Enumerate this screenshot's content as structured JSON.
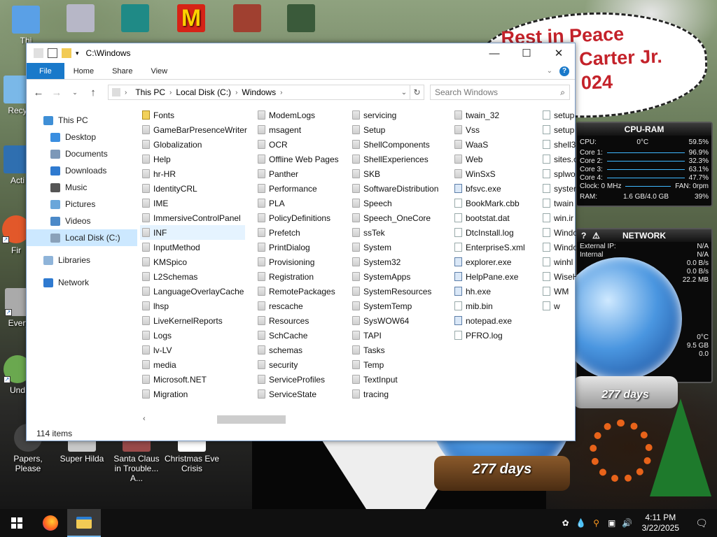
{
  "desktop": {
    "rip_lines": [
      "Rest in Peace",
      "arl Carter Jr.",
      "024"
    ],
    "icons": [
      {
        "label": "Thi",
        "color": "#5aa0e6"
      },
      {
        "label": "Recy",
        "color": "#7ab8e8"
      },
      {
        "label": "Acti",
        "color": "#2f6fb0"
      },
      {
        "label": "Fir",
        "color": "#e2582a"
      },
      {
        "label": "Every",
        "color": "#aaaaaa"
      },
      {
        "label": "Und",
        "color": "#6aa84f"
      },
      {
        "label": "Papers, Please",
        "color": "#444444"
      },
      {
        "label": "Super Hilda",
        "color": "#c9c9c9"
      },
      {
        "label": "Santa Claus in Trouble... A...",
        "color": "#9a4a4a"
      },
      {
        "label": "Christmas Eve Crisis",
        "color": "#ffffff"
      }
    ],
    "snowglobe_days": "277 days"
  },
  "explorer": {
    "title": "C:\\Windows",
    "window_controls": {
      "minimize": "—",
      "maximize": "☐",
      "close": "✕"
    },
    "ribbon_tabs": [
      "File",
      "Home",
      "Share",
      "View"
    ],
    "address": [
      "This PC",
      "Local Disk (C:)",
      "Windows"
    ],
    "search_placeholder": "Search Windows",
    "nav_items": [
      {
        "label": "This PC",
        "color": "#3f8fd6"
      },
      {
        "label": "Desktop",
        "color": "#3a8ee0"
      },
      {
        "label": "Documents",
        "color": "#7c98b8"
      },
      {
        "label": "Downloads",
        "color": "#2f7ad0"
      },
      {
        "label": "Music",
        "color": "#555555"
      },
      {
        "label": "Pictures",
        "color": "#6aa6da"
      },
      {
        "label": "Videos",
        "color": "#4b89c8"
      },
      {
        "label": "Local Disk (C:)",
        "color": "#8aa1b9"
      },
      {
        "label": "Libraries",
        "color": "#8fb4d9"
      },
      {
        "label": "Network",
        "color": "#2f7ad0"
      }
    ],
    "columns": [
      [
        "Fonts",
        "GameBarPresenceWriter",
        "Globalization",
        "Help",
        "hr-HR",
        "IdentityCRL",
        "IME",
        "ImmersiveControlPanel",
        "INF",
        "InputMethod",
        "KMSpico",
        "L2Schemas",
        "LanguageOverlayCache",
        "lhsp",
        "LiveKernelReports",
        "Logs",
        "lv-LV",
        "media",
        "Microsoft.NET",
        "Migration"
      ],
      [
        "ModemLogs",
        "msagent",
        "OCR",
        "Offline Web Pages",
        "Panther",
        "Performance",
        "PLA",
        "PolicyDefinitions",
        "Prefetch",
        "PrintDialog",
        "Provisioning",
        "Registration",
        "RemotePackages",
        "rescache",
        "Resources",
        "SchCache",
        "schemas",
        "security",
        "ServiceProfiles",
        "ServiceState"
      ],
      [
        "servicing",
        "Setup",
        "ShellComponents",
        "ShellExperiences",
        "SKB",
        "SoftwareDistribution",
        "Speech",
        "Speech_OneCore",
        "ssTek",
        "System",
        "System32",
        "SystemApps",
        "SystemResources",
        "SystemTemp",
        "SysWOW64",
        "TAPI",
        "Tasks",
        "Temp",
        "TextInput",
        "tracing"
      ],
      [
        "twain_32",
        "Vss",
        "WaaS",
        "Web",
        "WinSxS",
        "bfsvc.exe",
        "BookMark.cbb",
        "bootstat.dat",
        "DtcInstall.log",
        "EnterpriseS.xml",
        "explorer.exe",
        "HelpPane.exe",
        "hh.exe",
        "mib.bin",
        "notepad.exe",
        "PFRO.log"
      ],
      [
        "setup",
        "setup",
        "shell3",
        "sites.c",
        "splwo",
        "syster",
        "twain",
        "win.ir",
        "Windo",
        "Windo",
        "winhl",
        "WiseH",
        "WM",
        "w"
      ]
    ],
    "status": "114 items"
  },
  "cpu_gadget": {
    "title": "CPU-RAM",
    "rows": [
      {
        "label": "CPU:",
        "mid": "0°C",
        "value": "59.5%"
      },
      {
        "label": "Core 1:",
        "mid": "",
        "value": "96.9%"
      },
      {
        "label": "Core 2:",
        "mid": "",
        "value": "32.3%"
      },
      {
        "label": "Core 3:",
        "mid": "",
        "value": "63.1%"
      },
      {
        "label": "Core 4:",
        "mid": "",
        "value": "47.7%"
      },
      {
        "label": "Clock: 0 MHz",
        "mid": "",
        "value": "FAN: 0rpm"
      },
      {
        "label": "RAM:",
        "mid": "1.6 GB/4.0 GB",
        "value": "39%"
      }
    ]
  },
  "net_gadget": {
    "title": "NETWORK",
    "rows": [
      {
        "label": "External IP:",
        "value": "N/A"
      },
      {
        "label": "Internal",
        "value": "N/A"
      },
      {
        "label": "",
        "value": "0.0 B/s"
      },
      {
        "label": "",
        "value": "0.0 B/s"
      },
      {
        "label": "",
        "value": "22.2 MB"
      }
    ],
    "extra": [
      "0°C",
      "9.5 GB",
      "0.0"
    ]
  },
  "taskbar": {
    "time": "4:11 PM",
    "date": "3/22/2025"
  }
}
